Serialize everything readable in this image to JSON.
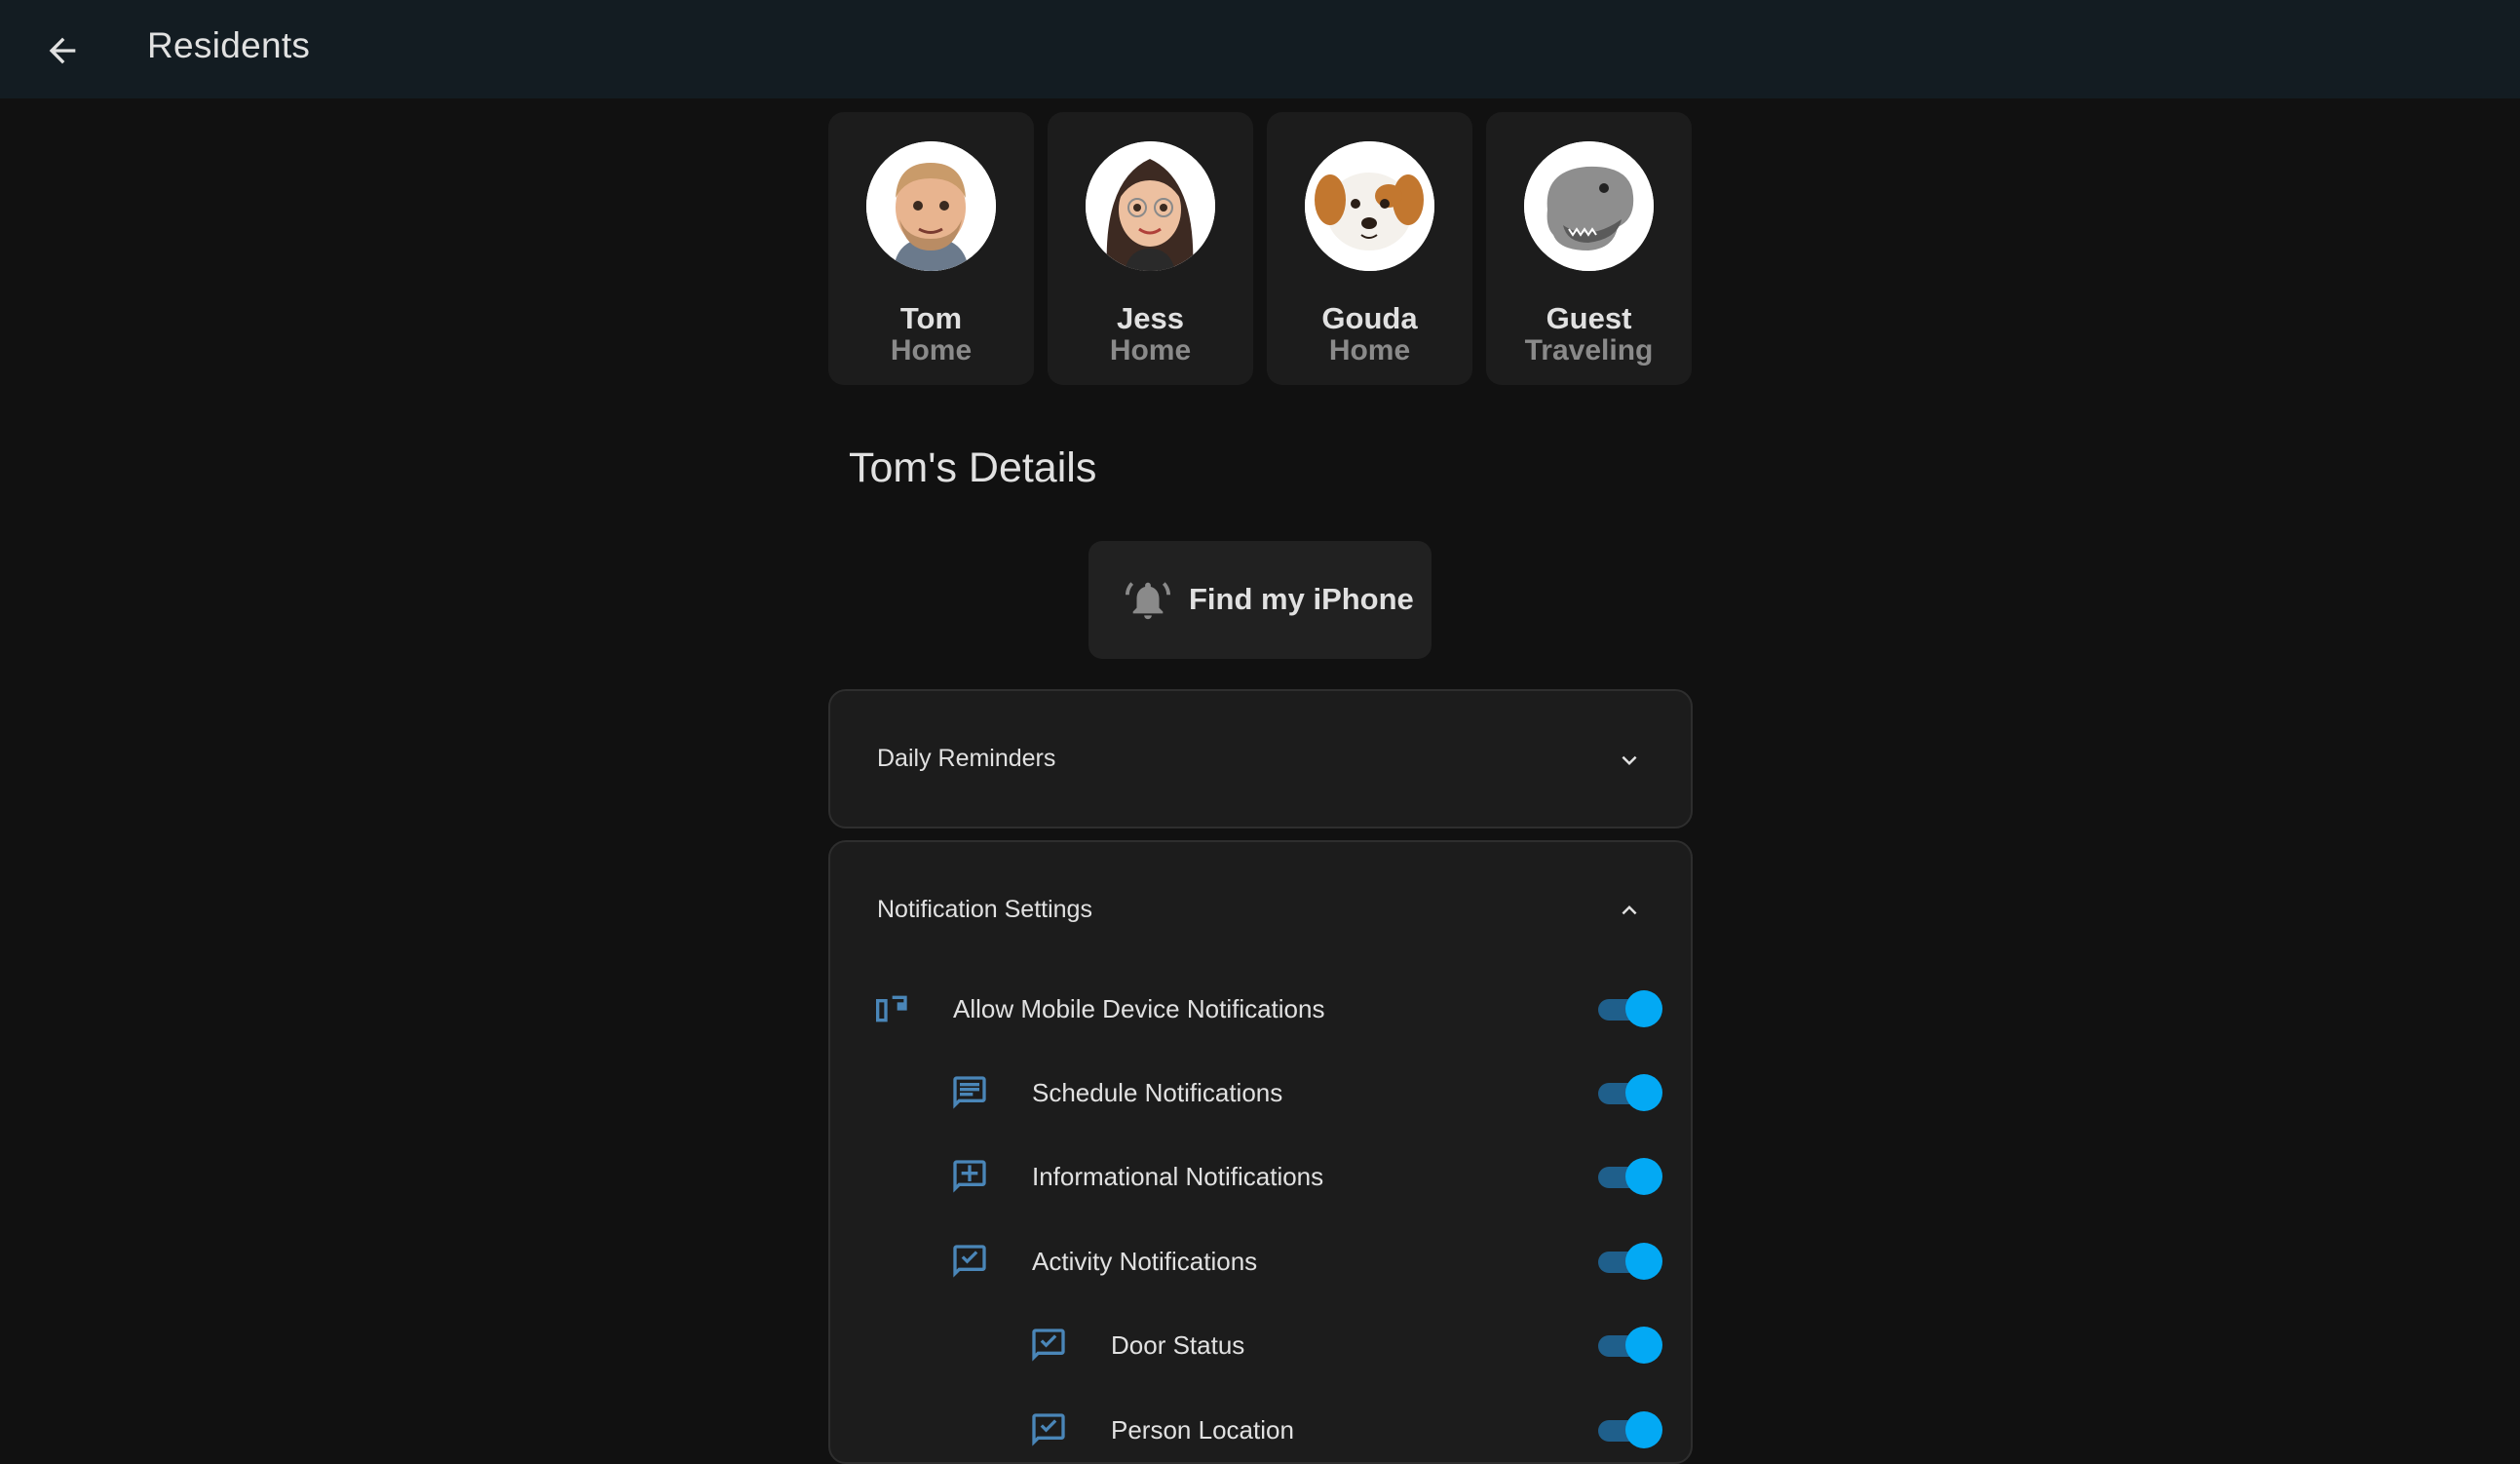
{
  "header": {
    "title": "Residents"
  },
  "residents": [
    {
      "name": "Tom",
      "status": "Home"
    },
    {
      "name": "Jess",
      "status": "Home"
    },
    {
      "name": "Gouda",
      "status": "Home"
    },
    {
      "name": "Guest",
      "status": "Traveling"
    }
  ],
  "details": {
    "title": "Tom's Details",
    "find_button": "Find my iPhone"
  },
  "daily_reminders": {
    "title": "Daily Reminders",
    "expanded": false
  },
  "notification_settings": {
    "title": "Notification Settings",
    "expanded": true,
    "items": [
      {
        "label": "Allow Mobile Device Notifications",
        "icon": "devices-icon",
        "enabled": true
      },
      {
        "label": "Schedule Notifications",
        "icon": "message-text-icon",
        "enabled": true
      },
      {
        "label": "Informational Notifications",
        "icon": "message-plus-icon",
        "enabled": true
      },
      {
        "label": "Activity Notifications",
        "icon": "message-check-icon",
        "enabled": true
      },
      {
        "label": "Door Status",
        "icon": "message-check-icon",
        "enabled": true
      },
      {
        "label": "Person Location",
        "icon": "message-check-icon",
        "enabled": true
      }
    ]
  },
  "colors": {
    "topbar": "#131c22",
    "background": "#111111",
    "card": "#1c1c1c",
    "accent": "#03a9f4",
    "icon": "#4a86b8"
  }
}
